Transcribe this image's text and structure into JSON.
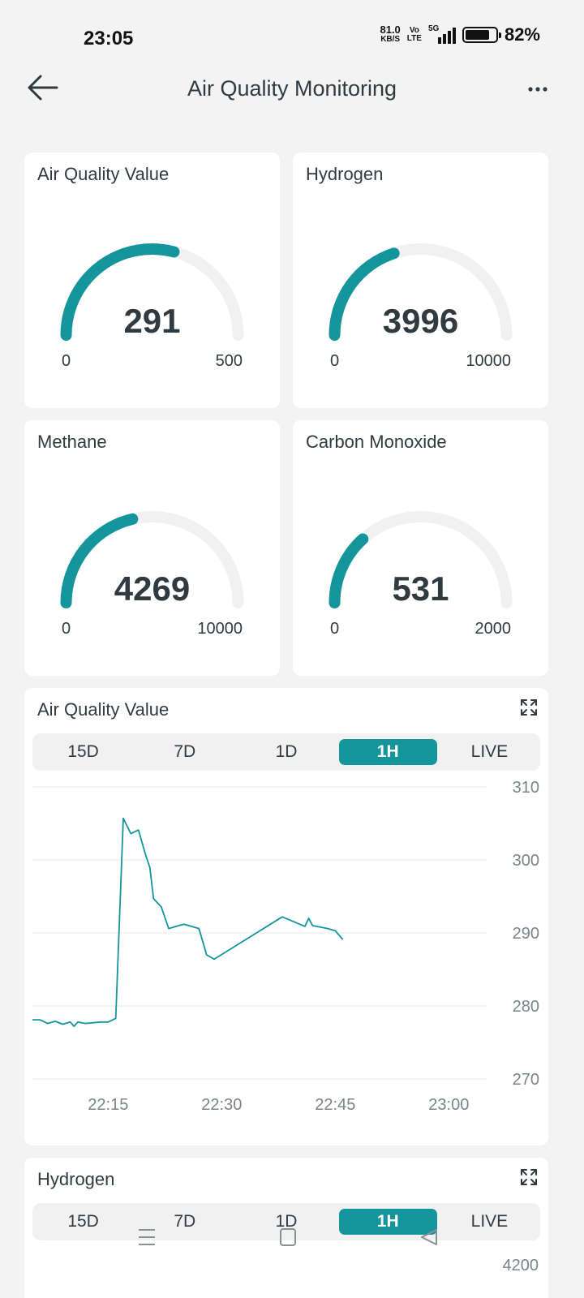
{
  "status": {
    "time": "23:05",
    "net_speed": "81.0",
    "net_unit": "KB/S",
    "volte_top": "Vo",
    "volte_bottom": "LTE",
    "network": "5G",
    "battery": "82%"
  },
  "header": {
    "title": "Air Quality Monitoring"
  },
  "colors": {
    "accent": "#13959b",
    "track": "#f1f1f1",
    "background": "#f3f3f3"
  },
  "gauges": [
    {
      "title": "Air Quality Value",
      "value": "291",
      "min": "0",
      "max": "500",
      "fraction": 0.582
    },
    {
      "title": "Hydrogen",
      "value": "3996",
      "min": "0",
      "max": "10000",
      "fraction": 0.3996
    },
    {
      "title": "Methane",
      "value": "4269",
      "min": "0",
      "max": "10000",
      "fraction": 0.4269
    },
    {
      "title": "Carbon Monoxide",
      "value": "531",
      "min": "0",
      "max": "2000",
      "fraction": 0.2655
    }
  ],
  "charts": [
    {
      "title": "Air Quality Value",
      "tabs": [
        "15D",
        "7D",
        "1D",
        "1H",
        "LIVE"
      ],
      "active_tab": "1H"
    },
    {
      "title": "Hydrogen",
      "tabs": [
        "15D",
        "7D",
        "1D",
        "1H",
        "LIVE"
      ],
      "active_tab": "1H",
      "first_tick": "4200"
    }
  ],
  "chart_data": {
    "type": "line",
    "title": "Air Quality Value",
    "ylim": [
      270,
      310
    ],
    "yticks": [
      "310",
      "300",
      "290",
      "280",
      "270"
    ],
    "xticks": [
      "22:15",
      "22:30",
      "22:45",
      "23:00"
    ],
    "xlim": [
      "22:05",
      "23:05"
    ],
    "grid": true,
    "series": [
      {
        "x": [
          "22:05",
          "22:06",
          "22:07",
          "22:08",
          "22:09",
          "22:10",
          "22:10.5",
          "22:11",
          "22:12",
          "22:13",
          "22:14",
          "22:15",
          "22:16",
          "22:17",
          "22:18",
          "22:19",
          "22:20",
          "22:20.5",
          "22:21",
          "22:22",
          "22:23",
          "22:24",
          "22:25",
          "22:26",
          "22:27",
          "22:28",
          "22:29",
          "22:38",
          "22:41",
          "22:41.5",
          "22:42",
          "22:43",
          "22:44",
          "22:45",
          "22:46"
        ],
        "y": [
          278.1,
          278.1,
          277.6,
          277.9,
          277.5,
          277.8,
          277.2,
          277.8,
          277.6,
          277.7,
          277.8,
          277.8,
          278.3,
          305.7,
          303.6,
          304.1,
          300.5,
          299.0,
          294.7,
          293.6,
          290.6,
          290.9,
          291.2,
          290.9,
          290.6,
          287.0,
          286.4,
          292.2,
          290.9,
          292.0,
          291.0,
          290.8,
          290.6,
          290.3,
          289.1
        ]
      }
    ]
  }
}
